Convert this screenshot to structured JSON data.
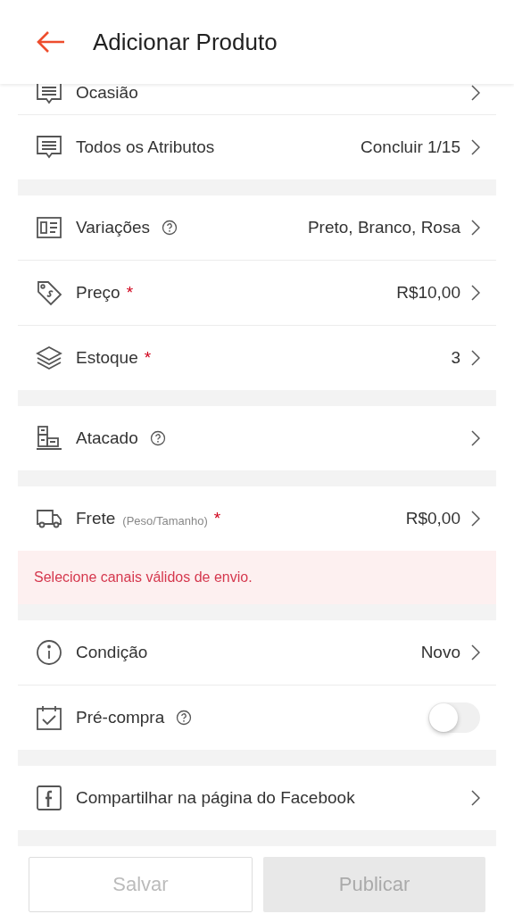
{
  "header": {
    "title": "Adicionar Produto"
  },
  "sections": [
    {
      "rows": [
        {
          "kind": "link",
          "label": "Ocasião",
          "partial": true,
          "chevron": true
        },
        {
          "kind": "link",
          "label": "Todos os Atributos",
          "value": "Concluir 1/15",
          "chevron": true
        }
      ]
    },
    {
      "rows": [
        {
          "kind": "link",
          "label": "Variações",
          "help": true,
          "value": "Preto, Branco, Rosa",
          "chevron": true
        },
        {
          "kind": "link",
          "label": "Preço",
          "required": "*",
          "value": "R$10,00",
          "chevron": true
        },
        {
          "kind": "link",
          "label": "Estoque",
          "required": "*",
          "value": "3",
          "chevron": true
        }
      ]
    },
    {
      "rows": [
        {
          "kind": "link",
          "label": "Atacado",
          "help": true,
          "chevron": true
        }
      ]
    },
    {
      "rows": [
        {
          "kind": "link",
          "label": "Frete",
          "note": "(Peso/Tamanho)",
          "required": "*",
          "value": "R$0,00",
          "chevron": true
        },
        {
          "kind": "error",
          "label": "Selecione canais válidos de envio."
        }
      ]
    },
    {
      "rows": [
        {
          "kind": "link",
          "label": "Condição",
          "value": "Novo",
          "chevron": true
        },
        {
          "kind": "toggle",
          "label": "Pré-compra",
          "help": true,
          "on": false
        }
      ]
    },
    {
      "rows": [
        {
          "kind": "link",
          "label": "Compartilhar na página do Facebook",
          "chevron": true
        }
      ]
    }
  ],
  "footer": {
    "buttons": [
      {
        "label": "Salvar",
        "kind": "outline",
        "disabled": true
      },
      {
        "label": "Publicar",
        "kind": "filled",
        "disabled": true
      }
    ]
  }
}
